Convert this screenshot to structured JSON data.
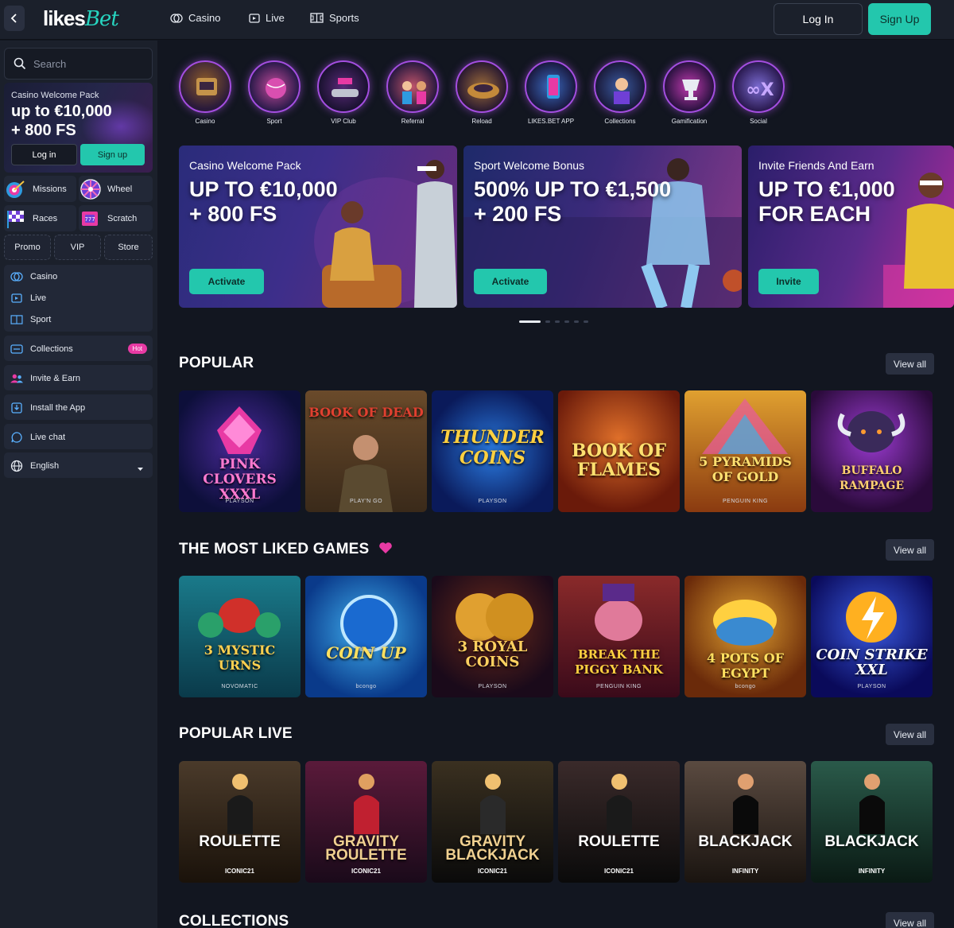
{
  "header": {
    "logo_text": "likes",
    "logo_accent": "Bet",
    "nav": [
      {
        "label": "Casino",
        "icon": "casino-chips-icon"
      },
      {
        "label": "Live",
        "icon": "live-tv-icon"
      },
      {
        "label": "Sports",
        "icon": "sports-field-icon"
      }
    ],
    "login_label": "Log In",
    "signup_label": "Sign Up"
  },
  "sidebar": {
    "search_placeholder": "Search",
    "promo": {
      "small": "Casino Welcome Pack",
      "line1": "up to €10,000",
      "line2": "+ 800 FS",
      "login_label": "Log in",
      "signup_label": "Sign up"
    },
    "tiles": [
      {
        "label": "Missions",
        "icon": "dart-target-icon"
      },
      {
        "label": "Wheel",
        "icon": "prize-wheel-icon"
      },
      {
        "label": "Races",
        "icon": "checkered-flag-icon"
      },
      {
        "label": "Scratch",
        "icon": "scratch-card-icon"
      }
    ],
    "pills": [
      "Promo",
      "VIP",
      "Store"
    ],
    "menu_games": [
      {
        "label": "Casino",
        "icon": "casino-chips-icon"
      },
      {
        "label": "Live",
        "icon": "live-tv-icon"
      },
      {
        "label": "Sport",
        "icon": "sports-field-icon"
      }
    ],
    "collections_label": "Collections",
    "hot_badge": "Hot",
    "invite_label": "Invite & Earn",
    "install_label": "Install the App",
    "live_chat_label": "Live chat",
    "language_label": "English"
  },
  "categories": [
    "Casino",
    "Sport",
    "VIP Club",
    "Referral",
    "Reload",
    "LIKES.BET APP",
    "Collections",
    "Gamification",
    "Social"
  ],
  "banners": [
    {
      "subtitle": "Casino Welcome Pack",
      "title1": "UP TO €10,000",
      "title2": "+ 800 FS",
      "button": "Activate"
    },
    {
      "subtitle": "Sport Welcome Bonus",
      "title1": "500% UP TO €1,500",
      "title2": "+ 200 FS",
      "button": "Activate"
    },
    {
      "subtitle": "Invite Friends And Earn",
      "title1": "UP TO €1,000",
      "title2": "FOR EACH",
      "button": "Invite"
    }
  ],
  "sections": {
    "popular": {
      "title": "POPULAR",
      "view_all": "View all",
      "games": [
        {
          "name": "PINK CLOVERS XXXL",
          "provider": "PLAYSON"
        },
        {
          "name": "BOOK OF DEAD",
          "provider": "PLAY'N GO"
        },
        {
          "name": "THUNDER COINS",
          "provider": "PLAYSON"
        },
        {
          "name": "BOOK OF FLAMES",
          "provider": ""
        },
        {
          "name": "5 PYRAMIDS OF GOLD",
          "provider": "PENGUIN KING"
        },
        {
          "name": "BUFFALO RAMPAGE",
          "provider": ""
        }
      ]
    },
    "liked": {
      "title": "THE MOST LIKED GAMES",
      "view_all": "View all",
      "games": [
        {
          "name": "3 MYSTIC URNS",
          "provider": "NOVOMATIC"
        },
        {
          "name": "COIN UP",
          "provider": "bcongo"
        },
        {
          "name": "3 ROYAL COINS",
          "provider": "PLAYSON"
        },
        {
          "name": "BREAK THE PIGGY BANK",
          "provider": "PENGUIN KING"
        },
        {
          "name": "4 POTS OF EGYPT",
          "provider": "bcongo"
        },
        {
          "name": "COIN STRIKE XXL",
          "provider": "PLAYSON"
        }
      ]
    },
    "live": {
      "title": "POPULAR LIVE",
      "view_all": "View all",
      "games": [
        {
          "name": "ROULETTE",
          "provider": "ICONIC21"
        },
        {
          "name": "GRAVITY ROULETTE",
          "provider": "ICONIC21"
        },
        {
          "name": "GRAVITY BLACKJACK",
          "provider": "ICONIC21"
        },
        {
          "name": "ROULETTE",
          "provider": "ICONIC21"
        },
        {
          "name": "BLACKJACK",
          "provider": "INFINITY"
        },
        {
          "name": "BLACKJACK",
          "provider": "INFINITY"
        }
      ]
    },
    "collections": {
      "title": "COLLECTIONS",
      "view_all": "View all"
    }
  },
  "colors": {
    "accent": "#23c7ad",
    "hot": "#e83aa4",
    "ring": "#a44ee0",
    "sidebar_bg": "#1b202b",
    "main_bg": "#121620"
  }
}
